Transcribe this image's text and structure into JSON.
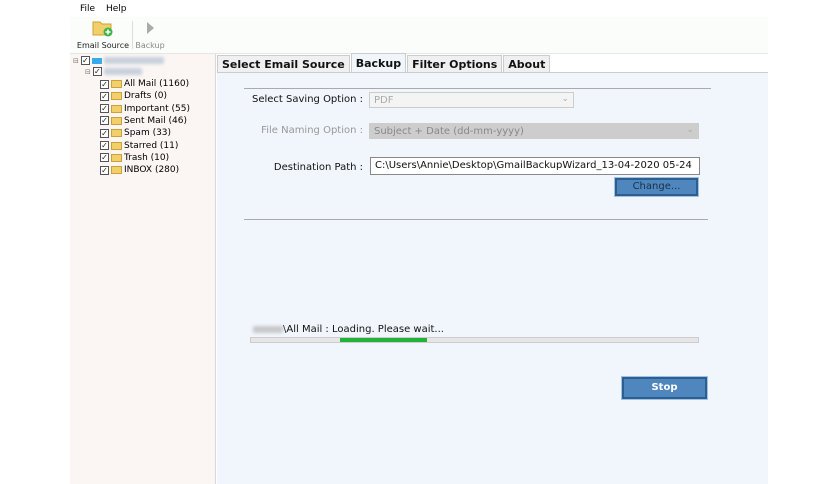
{
  "menu": {
    "items": [
      "File",
      "Help"
    ]
  },
  "toolbar": {
    "email_source": "Email Source",
    "backup": "Backup"
  },
  "tree": {
    "folders": [
      {
        "label": "All Mail (1160)",
        "icon": "folder-icon"
      },
      {
        "label": "Drafts (0)",
        "icon": "drafts-icon"
      },
      {
        "label": "Important (55)",
        "icon": "folder-icon"
      },
      {
        "label": "Sent Mail (46)",
        "icon": "sent-icon"
      },
      {
        "label": "Spam (33)",
        "icon": "folder-icon"
      },
      {
        "label": "Starred (11)",
        "icon": "folder-icon"
      },
      {
        "label": "Trash (10)",
        "icon": "trash-icon"
      },
      {
        "label": "INBOX (280)",
        "icon": "folder-icon"
      }
    ]
  },
  "tabs": [
    "Select Email Source",
    "Backup",
    "Filter Options",
    "About"
  ],
  "backup": {
    "saving_label": "Select Saving Option :",
    "saving_value": "PDF",
    "naming_label": "File Naming Option :",
    "naming_value": "Subject + Date (dd-mm-yyyy)",
    "dest_label": "Destination Path :",
    "dest_value": "C:\\Users\\Annie\\Desktop\\GmailBackupWizard_13-04-2020 05-24",
    "change_button": "Change...",
    "status": "\\All Mail : Loading. Please wait...",
    "stop_button": "Stop"
  },
  "colors": {
    "progress": "#21b339",
    "button": "#4f86bd",
    "panel": "#f0f6fc"
  }
}
